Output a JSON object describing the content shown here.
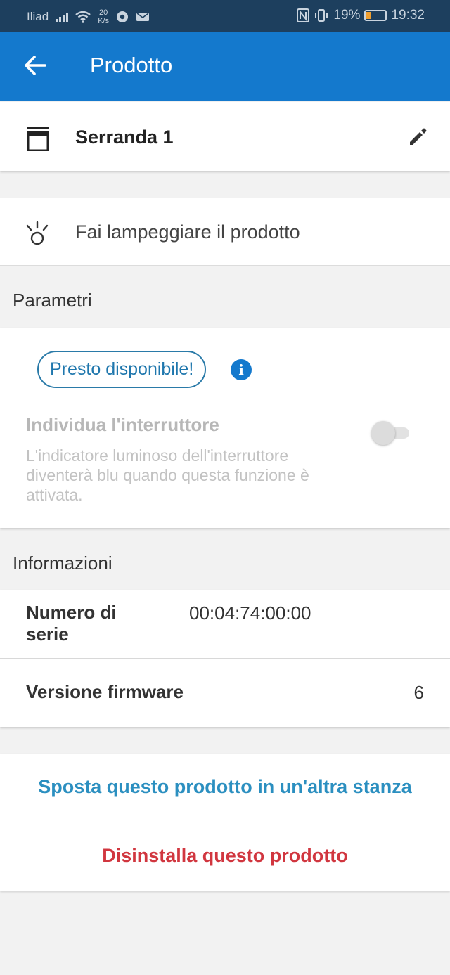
{
  "status_bar": {
    "carrier": "Iliad",
    "speed_value": "20",
    "speed_unit": "K/s",
    "battery": "19%",
    "time": "19:32"
  },
  "app_bar": {
    "title": "Prodotto",
    "back_icon": "arrow-left-icon"
  },
  "product": {
    "name": "Serranda 1",
    "icon": "shutter-icon",
    "edit_icon": "pencil-icon"
  },
  "blink": {
    "label": "Fai lampeggiare il prodotto",
    "icon": "blink-light-icon"
  },
  "parameters": {
    "section_title": "Parametri",
    "badge": "Presto disponibile!",
    "info_icon": "i",
    "locate_label": "Individua l'interruttore",
    "locate_description": "L'indicatore luminoso dell'interruttore diventerà blu quando questa funzione è attivata.",
    "toggle_on": false
  },
  "information": {
    "section_title": "Informazioni",
    "serial_label": "Numero di serie",
    "serial_value": "00:04:74:00:00",
    "firmware_label": "Versione firmware",
    "firmware_value": "6"
  },
  "actions": {
    "move_label": "Sposta questo prodotto in un'altra stanza",
    "uninstall_label": "Disinstalla questo prodotto",
    "move_color": "#2b8fc0",
    "uninstall_color": "#d1363f"
  }
}
